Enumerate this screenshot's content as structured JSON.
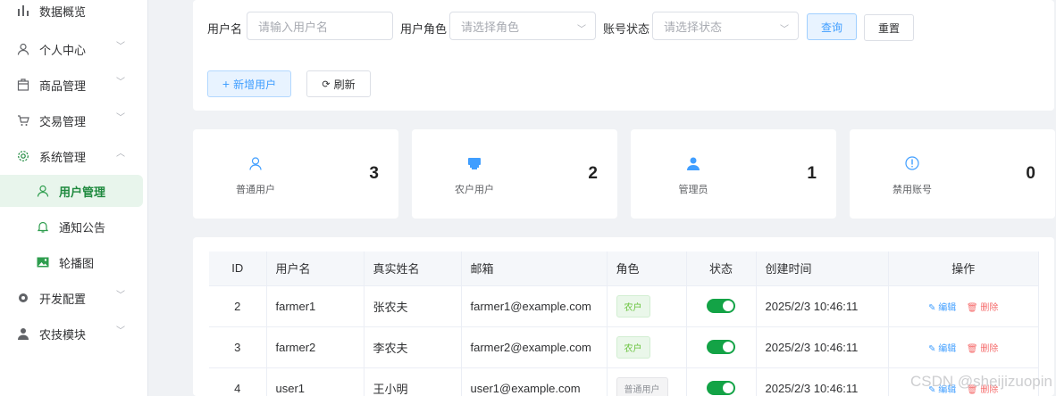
{
  "sidebar": {
    "items": [
      {
        "label": "数据概览",
        "icon": "bar-chart-icon"
      },
      {
        "label": "个人中心",
        "icon": "user-icon"
      },
      {
        "label": "商品管理",
        "icon": "goods-icon"
      },
      {
        "label": "交易管理",
        "icon": "cart-icon"
      },
      {
        "label": "系统管理",
        "icon": "gear-icon"
      },
      {
        "label": "开发配置",
        "icon": "settings-icon"
      },
      {
        "label": "农技模块",
        "icon": "person-icon"
      }
    ],
    "submenu": [
      {
        "label": "用户管理",
        "icon": "user-icon",
        "active": true
      },
      {
        "label": "通知公告",
        "icon": "bell-icon"
      },
      {
        "label": "轮播图",
        "icon": "image-icon"
      }
    ]
  },
  "search": {
    "username_label": "用户名",
    "username_placeholder": "请输入用户名",
    "role_label": "用户角色",
    "role_placeholder": "请选择角色",
    "status_label": "账号状态",
    "status_placeholder": "请选择状态",
    "query_label": "查询",
    "reset_label": "重置",
    "add_label": "新增用户",
    "refresh_label": "刷新"
  },
  "stats": [
    {
      "label": "普通用户",
      "value": "3",
      "icon": "user-outline-icon",
      "color": "#409eff"
    },
    {
      "label": "农户用户",
      "value": "2",
      "icon": "shop-icon",
      "color": "#409eff"
    },
    {
      "label": "管理员",
      "value": "1",
      "icon": "admin-icon",
      "color": "#409eff"
    },
    {
      "label": "禁用账号",
      "value": "0",
      "icon": "warning-icon",
      "color": "#409eff"
    }
  ],
  "table": {
    "headers": [
      "ID",
      "用户名",
      "真实姓名",
      "邮箱",
      "角色",
      "状态",
      "创建时间",
      "操作"
    ],
    "rows": [
      {
        "id": "2",
        "username": "farmer1",
        "realname": "张农夫",
        "email": "farmer1@example.com",
        "role": "农户",
        "created": "2025/2/3 10:46:11"
      },
      {
        "id": "3",
        "username": "farmer2",
        "realname": "李农夫",
        "email": "farmer2@example.com",
        "role": "农户",
        "created": "2025/2/3 10:46:11"
      },
      {
        "id": "4",
        "username": "user1",
        "realname": "王小明",
        "email": "user1@example.com",
        "role": "普通用户",
        "created": "2025/2/3 10:46:11"
      }
    ],
    "edit_label": "编辑",
    "delete_label": "删除"
  },
  "watermark": "CSDN @sheijizuopin",
  "colors": {
    "accent": "#409eff",
    "success": "#13a346",
    "danger": "#f56c6c"
  }
}
